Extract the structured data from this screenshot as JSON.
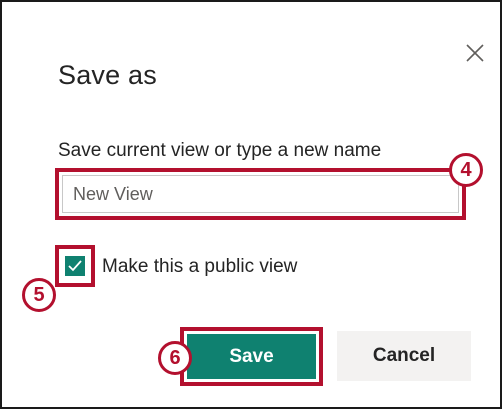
{
  "dialog": {
    "title": "Save as",
    "field_label": "Save current view or type a new name",
    "input_value": "New View",
    "checkbox_label": "Make this a public view",
    "checkbox_checked": true,
    "save_label": "Save",
    "cancel_label": "Cancel",
    "close_icon": "close-icon"
  },
  "annotations": {
    "step_input": "4",
    "step_checkbox": "5",
    "step_save": "6"
  },
  "colors": {
    "accent": "#0f8170",
    "highlight": "#b3102e",
    "cancel_bg": "#f3f2f1"
  }
}
